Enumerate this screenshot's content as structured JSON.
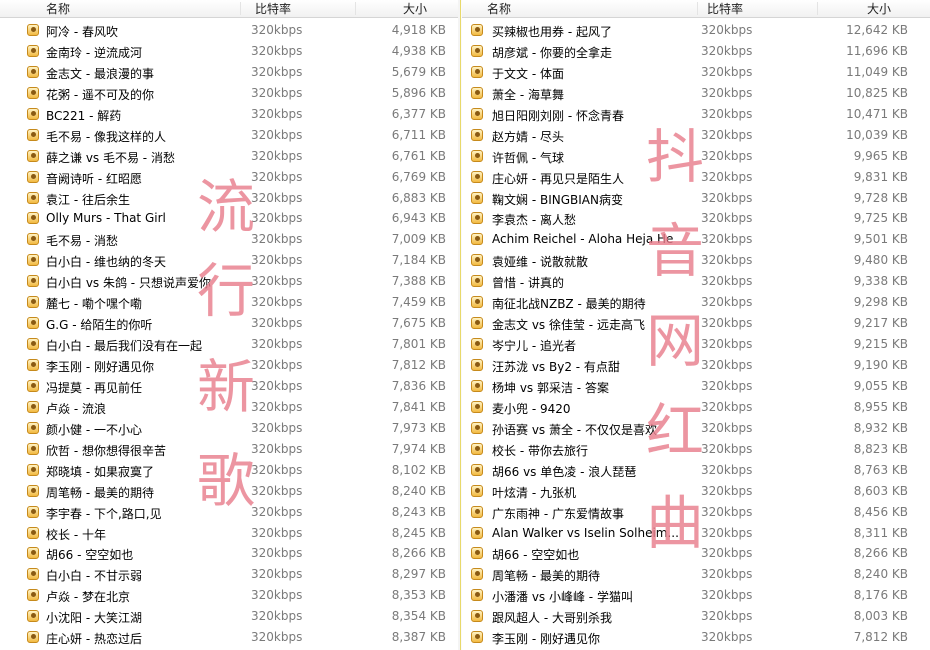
{
  "columns": {
    "name": "名称",
    "bitrate": "比特率",
    "size": "大小"
  },
  "watermark_left": [
    "流",
    "行",
    "新",
    "歌"
  ],
  "watermark_right": [
    "抖",
    "音",
    "网",
    "红",
    "曲"
  ],
  "left_rows": [
    {
      "name": "阿冷 - 春风吹",
      "bitrate": "320kbps",
      "size": "4,918 KB"
    },
    {
      "name": "金南玲 - 逆流成河",
      "bitrate": "320kbps",
      "size": "4,938 KB"
    },
    {
      "name": "金志文 - 最浪漫的事",
      "bitrate": "320kbps",
      "size": "5,679 KB"
    },
    {
      "name": "花粥 - 遥不可及的你",
      "bitrate": "320kbps",
      "size": "5,896 KB"
    },
    {
      "name": "BC221 - 解药",
      "bitrate": "320kbps",
      "size": "6,377 KB"
    },
    {
      "name": "毛不易 - 像我这样的人",
      "bitrate": "320kbps",
      "size": "6,711 KB"
    },
    {
      "name": "薛之谦 vs 毛不易 - 消愁",
      "bitrate": "320kbps",
      "size": "6,761 KB"
    },
    {
      "name": "音阙诗听 - 红昭愿",
      "bitrate": "320kbps",
      "size": "6,769 KB"
    },
    {
      "name": "袁江 - 往后余生",
      "bitrate": "320kbps",
      "size": "6,883 KB"
    },
    {
      "name": "Olly Murs - That Girl",
      "bitrate": "320kbps",
      "size": "6,943 KB"
    },
    {
      "name": "毛不易 - 消愁",
      "bitrate": "320kbps",
      "size": "7,009 KB"
    },
    {
      "name": "白小白 - 维也纳的冬天",
      "bitrate": "320kbps",
      "size": "7,184 KB"
    },
    {
      "name": "白小白 vs 朱鸽 - 只想说声爱你",
      "bitrate": "320kbps",
      "size": "7,388 KB"
    },
    {
      "name": "麓七 - 嘞个嘿个嘞",
      "bitrate": "320kbps",
      "size": "7,459 KB"
    },
    {
      "name": "G.G - 给陌生的你听",
      "bitrate": "320kbps",
      "size": "7,675 KB"
    },
    {
      "name": "白小白 - 最后我们没有在一起",
      "bitrate": "320kbps",
      "size": "7,801 KB"
    },
    {
      "name": "李玉刚 - 刚好遇见你",
      "bitrate": "320kbps",
      "size": "7,812 KB"
    },
    {
      "name": "冯提莫 - 再见前任",
      "bitrate": "320kbps",
      "size": "7,836 KB"
    },
    {
      "name": "卢焱 - 流浪",
      "bitrate": "320kbps",
      "size": "7,841 KB"
    },
    {
      "name": "颜小健 - 一不小心",
      "bitrate": "320kbps",
      "size": "7,973 KB"
    },
    {
      "name": "欣哲 - 想你想得很辛苦",
      "bitrate": "320kbps",
      "size": "7,974 KB"
    },
    {
      "name": "郑晓填 - 如果寂寞了",
      "bitrate": "320kbps",
      "size": "8,102 KB"
    },
    {
      "name": "周笔畅 - 最美的期待",
      "bitrate": "320kbps",
      "size": "8,240 KB"
    },
    {
      "name": "李宇春 - 下个,路口,见",
      "bitrate": "320kbps",
      "size": "8,243 KB"
    },
    {
      "name": "校长 - 十年",
      "bitrate": "320kbps",
      "size": "8,245 KB"
    },
    {
      "name": "胡66 - 空空如也",
      "bitrate": "320kbps",
      "size": "8,266 KB"
    },
    {
      "name": "白小白 - 不甘示弱",
      "bitrate": "320kbps",
      "size": "8,297 KB"
    },
    {
      "name": "卢焱 - 梦在北京",
      "bitrate": "320kbps",
      "size": "8,353 KB"
    },
    {
      "name": "小沈阳 - 大笑江湖",
      "bitrate": "320kbps",
      "size": "8,354 KB"
    },
    {
      "name": "庄心妍 - 热恋过后",
      "bitrate": "320kbps",
      "size": "8,387 KB"
    }
  ],
  "right_rows": [
    {
      "name": "买辣椒也用券 - 起风了",
      "bitrate": "320kbps",
      "size": "12,642 KB"
    },
    {
      "name": "胡彦斌 - 你要的全拿走",
      "bitrate": "320kbps",
      "size": "11,696 KB"
    },
    {
      "name": "于文文 - 体面",
      "bitrate": "320kbps",
      "size": "11,049 KB"
    },
    {
      "name": "萧全 - 海草舞",
      "bitrate": "320kbps",
      "size": "10,825 KB"
    },
    {
      "name": "旭日阳刚刘刚 - 怀念青春",
      "bitrate": "320kbps",
      "size": "10,471 KB"
    },
    {
      "name": "赵方婧 - 尽头",
      "bitrate": "320kbps",
      "size": "10,039 KB"
    },
    {
      "name": "许哲佩 - 气球",
      "bitrate": "320kbps",
      "size": "9,965 KB"
    },
    {
      "name": "庄心妍 - 再见只是陌生人",
      "bitrate": "320kbps",
      "size": "9,831 KB"
    },
    {
      "name": "鞠文娴 - BINGBIAN病变",
      "bitrate": "320kbps",
      "size": "9,728 KB"
    },
    {
      "name": "李袁杰 - 离人愁",
      "bitrate": "320kbps",
      "size": "9,725 KB"
    },
    {
      "name": "Achim Reichel - Aloha Heja He",
      "bitrate": "320kbps",
      "size": "9,501 KB"
    },
    {
      "name": "袁娅维 - 说散就散",
      "bitrate": "320kbps",
      "size": "9,480 KB"
    },
    {
      "name": "曾惜 - 讲真的",
      "bitrate": "320kbps",
      "size": "9,338 KB"
    },
    {
      "name": "南征北战NZBZ - 最美的期待",
      "bitrate": "320kbps",
      "size": "9,298 KB"
    },
    {
      "name": "金志文 vs 徐佳莹 - 远走高飞",
      "bitrate": "320kbps",
      "size": "9,217 KB"
    },
    {
      "name": "岑宁儿 - 追光者",
      "bitrate": "320kbps",
      "size": "9,215 KB"
    },
    {
      "name": "汪苏泷 vs By2 - 有点甜",
      "bitrate": "320kbps",
      "size": "9,190 KB"
    },
    {
      "name": "杨坤 vs 郭采洁 - 答案",
      "bitrate": "320kbps",
      "size": "9,055 KB"
    },
    {
      "name": "麦小兜 - 9420",
      "bitrate": "320kbps",
      "size": "8,955 KB"
    },
    {
      "name": "孙语赛 vs 萧全 - 不仅仅是喜欢",
      "bitrate": "320kbps",
      "size": "8,932 KB"
    },
    {
      "name": "校长 - 带你去旅行",
      "bitrate": "320kbps",
      "size": "8,823 KB"
    },
    {
      "name": "胡66 vs 单色凌 - 浪人琵琶",
      "bitrate": "320kbps",
      "size": "8,763 KB"
    },
    {
      "name": "叶炫清 - 九张机",
      "bitrate": "320kbps",
      "size": "8,603 KB"
    },
    {
      "name": "广东雨神 - 广东爱情故事",
      "bitrate": "320kbps",
      "size": "8,456 KB"
    },
    {
      "name": "Alan Walker vs Iselin Solheim...",
      "bitrate": "320kbps",
      "size": "8,311 KB"
    },
    {
      "name": "胡66 - 空空如也",
      "bitrate": "320kbps",
      "size": "8,266 KB"
    },
    {
      "name": "周笔畅 - 最美的期待",
      "bitrate": "320kbps",
      "size": "8,240 KB"
    },
    {
      "name": "小潘潘 vs 小峰峰 - 学猫叫",
      "bitrate": "320kbps",
      "size": "8,176 KB"
    },
    {
      "name": "跟风超人 - 大哥别杀我",
      "bitrate": "320kbps",
      "size": "8,003 KB"
    },
    {
      "name": "李玉刚 - 刚好遇见你",
      "bitrate": "320kbps",
      "size": "7,812 KB"
    }
  ]
}
